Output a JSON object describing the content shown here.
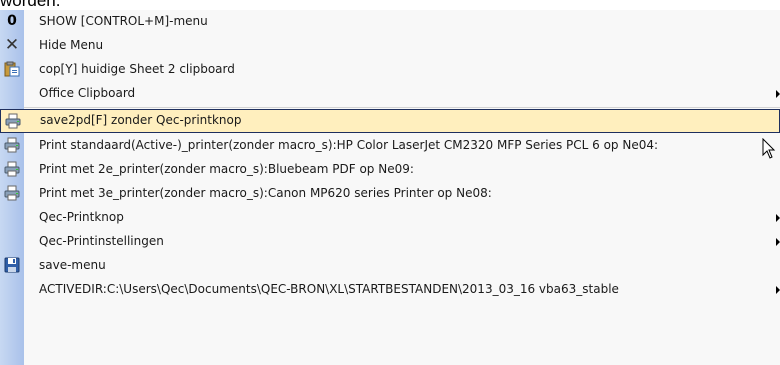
{
  "top_text": "worden.",
  "menu": {
    "items": [
      {
        "icon": "zero-icon",
        "label": "SHOW [CONTROL+M]-menu",
        "submenu": false
      },
      {
        "icon": "x-icon",
        "label": "Hide Menu",
        "submenu": false
      },
      {
        "icon": "clipboard-copy-icon",
        "label": "cop[Y] huidige Sheet 2 clipboard",
        "submenu": false
      },
      {
        "icon": "",
        "label": "Office Clipboard",
        "submenu": true
      },
      {
        "icon": "printer-icon",
        "label": "save2pd[F] zonder Qec-printknop",
        "submenu": false,
        "highlighted": true
      },
      {
        "icon": "printer-icon",
        "label": "Print standaard(Active-)_printer(zonder macro_s):HP Color LaserJet CM2320 MFP Series PCL 6 op Ne04:",
        "submenu": false
      },
      {
        "icon": "printer-icon",
        "label": "Print met 2e_printer(zonder macro_s):Bluebeam PDF op Ne09:",
        "submenu": false
      },
      {
        "icon": "printer-icon",
        "label": "Print met 3e_printer(zonder macro_s):Canon MP620 series Printer op Ne08:",
        "submenu": false
      },
      {
        "icon": "",
        "label": "Qec-Printknop",
        "submenu": true
      },
      {
        "icon": "",
        "label": "Qec-Printinstellingen",
        "submenu": true
      },
      {
        "icon": "floppy-disk-icon",
        "label": "save-menu",
        "submenu": false
      },
      {
        "icon": "",
        "label": "ACTIVEDIR:C:\\Users\\Qec\\Documents\\QEC-BRON\\XL\\STARTBESTANDEN\\2013_03_16 vba63_stable",
        "submenu": true
      }
    ]
  }
}
